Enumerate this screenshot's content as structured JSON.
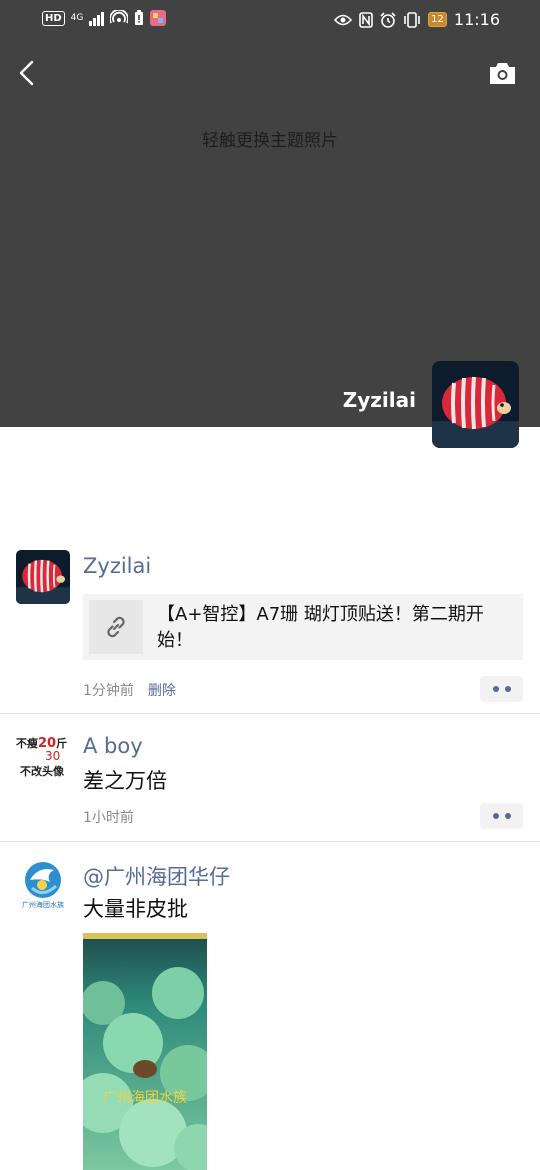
{
  "status_bar": {
    "left_icons": [
      "HD",
      "4G",
      "signal-icon",
      "hotspot-icon",
      "battery-alert-icon",
      "app-icon"
    ],
    "network": "4G",
    "right_icons": [
      "eye-icon",
      "nfc-icon",
      "alarm-icon",
      "vibrate-icon"
    ],
    "battery_level": "12",
    "time": "11:16"
  },
  "cover": {
    "hint": "轻触更换主题照片",
    "profile_name": "Zyzilai"
  },
  "posts": [
    {
      "nick": "Zyzilai",
      "link_title": "【A+智控】A7珊 瑚灯顶贴送！第二期开始！",
      "time": "1分钟前",
      "delete_label": "删除"
    },
    {
      "nick": "A boy",
      "avatar_text_top": "不瘦",
      "avatar_text_num": "20",
      "avatar_text_unit": "斤",
      "avatar_text_extra": "30",
      "avatar_text_bottom": "不改头像",
      "text": "差之万倍",
      "time": "1小时前"
    },
    {
      "nick": "@广州海团华仔",
      "avatar_logo_text": "广州海团水族",
      "text": "大量非皮批",
      "media_watermark": "广州海团水族"
    }
  ],
  "colors": {
    "nick": "#576b95",
    "cover": "#424242"
  }
}
